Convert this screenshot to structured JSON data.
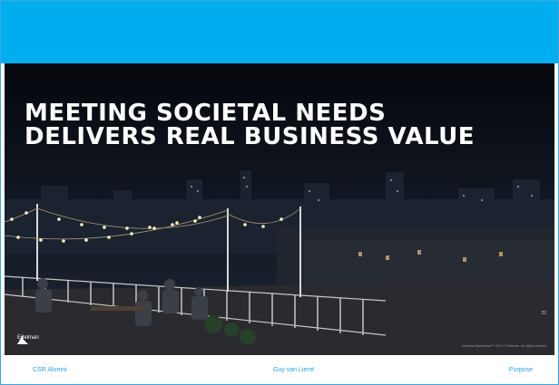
{
  "slide": {
    "headline": "MEETING SOCIETAL NEEDS\nDELIVERS REAL BUSINESS VALUE",
    "logo_text": "Edelman",
    "slide_number": "22",
    "copyright": "Edelman Brandshare™ 2014 © Edelman. All rights reserved."
  },
  "footer": {
    "left": "CSR Alumni",
    "center": "Guy van Liemt",
    "right": "Purpose"
  },
  "colors": {
    "band": "#00aeef",
    "footer_text": "#2a9fdb"
  }
}
